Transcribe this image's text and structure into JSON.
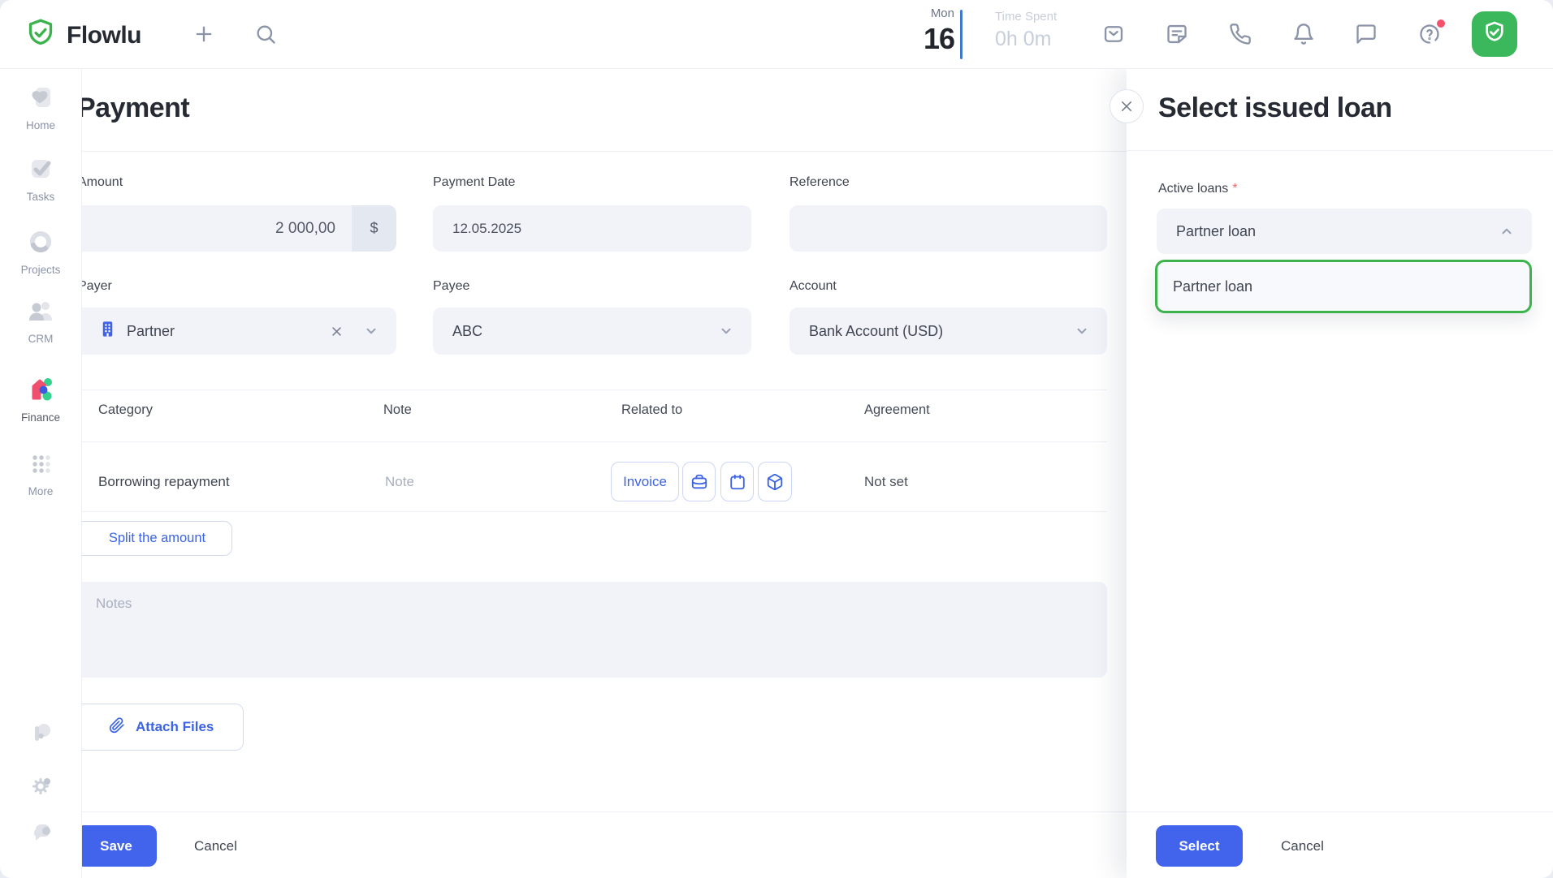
{
  "topbar": {
    "brand": "Flowlu",
    "date": {
      "weekday": "Mon",
      "day": "16"
    },
    "time_spent": {
      "label": "Time Spent",
      "value": "0h 0m"
    },
    "icons": [
      "plus-icon",
      "search-icon",
      "mail-icon",
      "notes-icon",
      "phone-icon",
      "bell-icon",
      "chat-icon",
      "help-icon",
      "profile-shield-icon"
    ]
  },
  "sidebar": {
    "items": [
      {
        "label": "Home",
        "icon": "home-icon"
      },
      {
        "label": "Tasks",
        "icon": "tasks-icon"
      },
      {
        "label": "Projects",
        "icon": "projects-icon"
      },
      {
        "label": "CRM",
        "icon": "crm-icon"
      },
      {
        "label": "Finance",
        "icon": "finance-icon",
        "active": true
      },
      {
        "label": "More",
        "icon": "more-grid-icon"
      }
    ],
    "bottom_icons": [
      "integrations-icon",
      "settings-gear-icon",
      "feedback-bubble-icon"
    ]
  },
  "payment": {
    "title": "Payment",
    "amount": {
      "label": "Amount",
      "value": "2 000,00",
      "currency": "$"
    },
    "payment_date": {
      "label": "Payment Date",
      "value": "12.05.2025"
    },
    "reference": {
      "label": "Reference",
      "value": ""
    },
    "payer": {
      "label": "Payer",
      "value": "Partner",
      "icon": "building-icon"
    },
    "payee": {
      "label": "Payee",
      "value": "ABC"
    },
    "account": {
      "label": "Account",
      "value": "Bank Account (USD)"
    },
    "table": {
      "headers": [
        "Category",
        "Note",
        "Related to",
        "Agreement"
      ],
      "row": {
        "category": "Borrowing repayment",
        "note_placeholder": "Note",
        "invoice_button": "Invoice",
        "related_icons": [
          "briefcase-icon",
          "calendar-icon",
          "box-icon"
        ],
        "agreement": "Not set"
      }
    },
    "split_button": "Split the amount",
    "notes_placeholder": "Notes",
    "attach_button": "Attach Files",
    "footer": {
      "save": "Save",
      "cancel": "Cancel"
    }
  },
  "loan_dialog": {
    "title": "Select issued loan",
    "field_label": "Active loans",
    "required_mark": "*",
    "selected_value": "Partner loan",
    "options": [
      "Partner loan"
    ],
    "footer": {
      "select": "Select",
      "cancel": "Cancel"
    }
  },
  "colors": {
    "primary_blue": "#4263eb",
    "brand_green": "#3bb24d",
    "avatar_green": "#3cb85c",
    "highlight_green_border": "#3cb34c",
    "input_bg": "#f1f3f9",
    "divider": "#edeff4",
    "muted_icon": "#8b93a8",
    "placeholder": "#a8afbd",
    "danger_red": "#f4516c"
  }
}
